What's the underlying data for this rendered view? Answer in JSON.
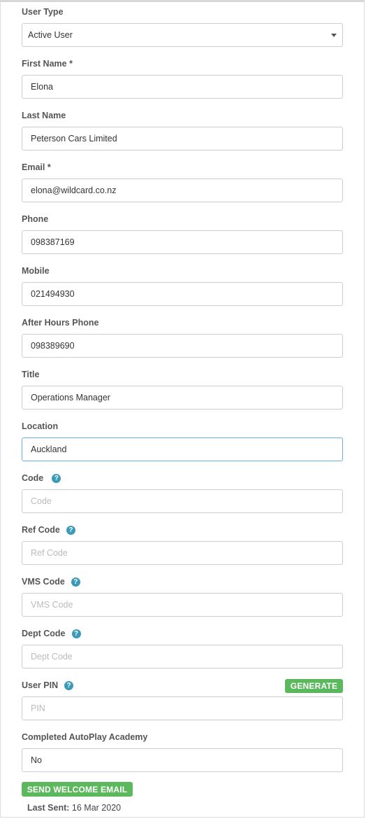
{
  "form": {
    "user_type": {
      "label": "User Type",
      "value": "Active User"
    },
    "first_name": {
      "label": "First Name *",
      "value": "Elona"
    },
    "last_name": {
      "label": "Last Name",
      "value": "Peterson Cars Limited"
    },
    "email": {
      "label": "Email *",
      "value": "elona@wildcard.co.nz"
    },
    "phone": {
      "label": "Phone",
      "value": "098387169"
    },
    "mobile": {
      "label": "Mobile",
      "value": "021494930"
    },
    "after_hours_phone": {
      "label": "After Hours Phone",
      "value": "098389690"
    },
    "title": {
      "label": "Title",
      "value": "Operations Manager"
    },
    "location": {
      "label": "Location",
      "value": "Auckland"
    },
    "code": {
      "label": "Code",
      "placeholder": "Code",
      "value": ""
    },
    "ref_code": {
      "label": "Ref Code",
      "placeholder": "Ref Code",
      "value": ""
    },
    "vms_code": {
      "label": "VMS Code",
      "placeholder": "VMS Code",
      "value": ""
    },
    "dept_code": {
      "label": "Dept Code",
      "placeholder": "Dept Code",
      "value": ""
    },
    "user_pin": {
      "label": "User PIN",
      "placeholder": "PIN",
      "value": "",
      "generate_label": "GENERATE"
    },
    "autoplay_academy": {
      "label": "Completed AutoPlay Academy",
      "value": "No"
    }
  },
  "help_icon_glyph": "?",
  "welcome": {
    "button_label": "SEND WELCOME EMAIL",
    "last_sent_label": "Last Sent:",
    "last_sent_value": "16 Mar 2020"
  },
  "colors": {
    "accent_green": "#5cb85c",
    "help_icon_blue": "#3a9ab8",
    "focus_border": "#66afe9"
  },
  "icons": {
    "help": "question-circle-icon",
    "select_caret": "caret-down-icon"
  }
}
